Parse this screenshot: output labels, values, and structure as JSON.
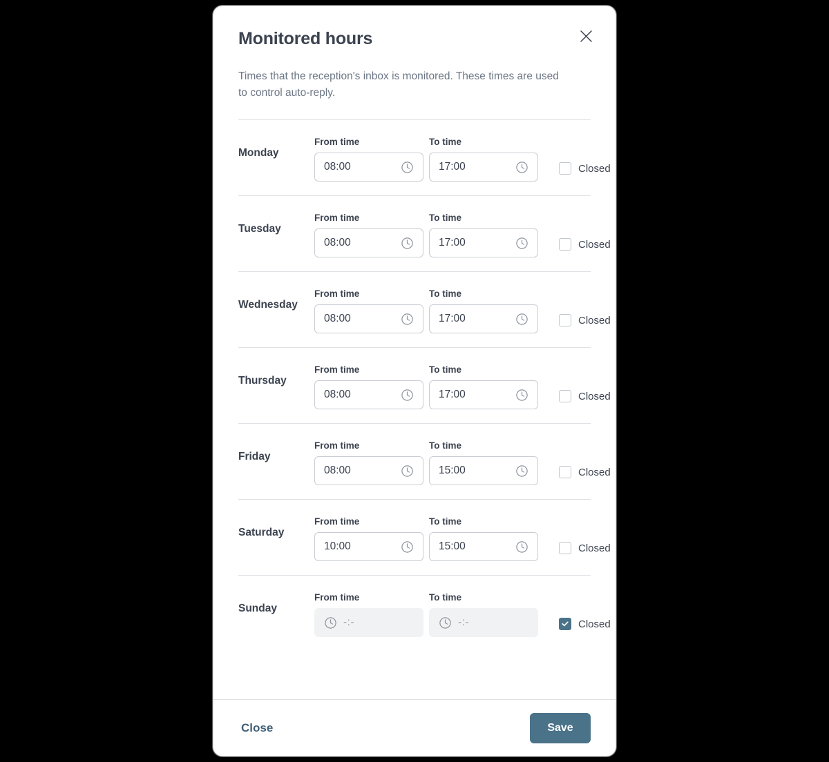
{
  "modal": {
    "title": "Monitored hours",
    "description": "Times that the reception's inbox is monitored. These times are used to control auto-reply.",
    "close_icon": "close-icon"
  },
  "labels": {
    "from_time": "From time",
    "to_time": "To time",
    "closed": "Closed",
    "clock_icon": "clock-icon",
    "disabled_placeholder": "-:-"
  },
  "colors": {
    "accent": "#4a7289",
    "link": "#426179",
    "text": "#3c4350",
    "muted": "#6c7685",
    "border": "#dfe1e4",
    "input_border": "#c9cdd3",
    "disabled_bg": "#f1f2f3"
  },
  "days": [
    {
      "name": "Monday",
      "from": "08:00",
      "to": "17:00",
      "closed": false
    },
    {
      "name": "Tuesday",
      "from": "08:00",
      "to": "17:00",
      "closed": false
    },
    {
      "name": "Wednesday",
      "from": "08:00",
      "to": "17:00",
      "closed": false
    },
    {
      "name": "Thursday",
      "from": "08:00",
      "to": "17:00",
      "closed": false
    },
    {
      "name": "Friday",
      "from": "08:00",
      "to": "15:00",
      "closed": false
    },
    {
      "name": "Saturday",
      "from": "10:00",
      "to": "15:00",
      "closed": false
    },
    {
      "name": "Sunday",
      "from": "-:-",
      "to": "-:-",
      "closed": true
    }
  ],
  "footer": {
    "close_label": "Close",
    "save_label": "Save"
  }
}
